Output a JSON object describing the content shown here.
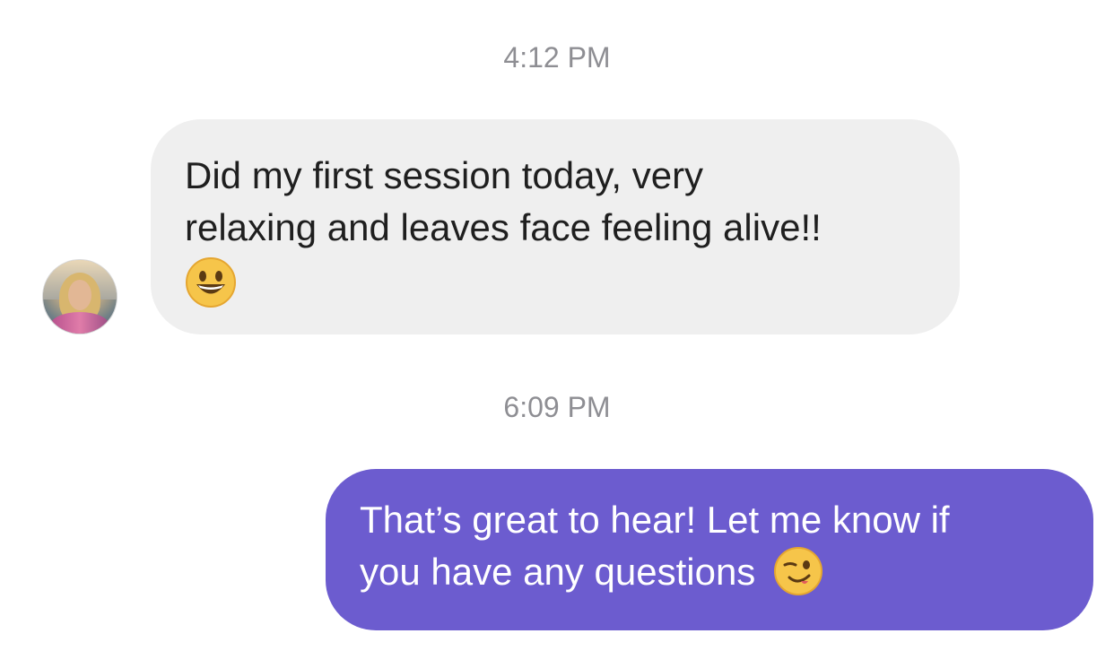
{
  "conversation": {
    "messages": [
      {
        "timestamp": "4:12 PM",
        "direction": "incoming",
        "line1": "Did my first session today, very",
        "line2": "relaxing and leaves face feeling alive!!",
        "emoji": "grinning-face-emoji"
      },
      {
        "timestamp": "6:09 PM",
        "direction": "outgoing",
        "line1": "That’s great to hear! Let me know if",
        "line2": "you have any questions",
        "emoji": "winking-face-emoji"
      }
    ]
  },
  "colors": {
    "incoming_bubble": "#efefef",
    "outgoing_bubble": "#6c5ccf",
    "timestamp_text": "#8e8e93",
    "incoming_text": "#1f1f1f",
    "outgoing_text": "#ffffff"
  }
}
